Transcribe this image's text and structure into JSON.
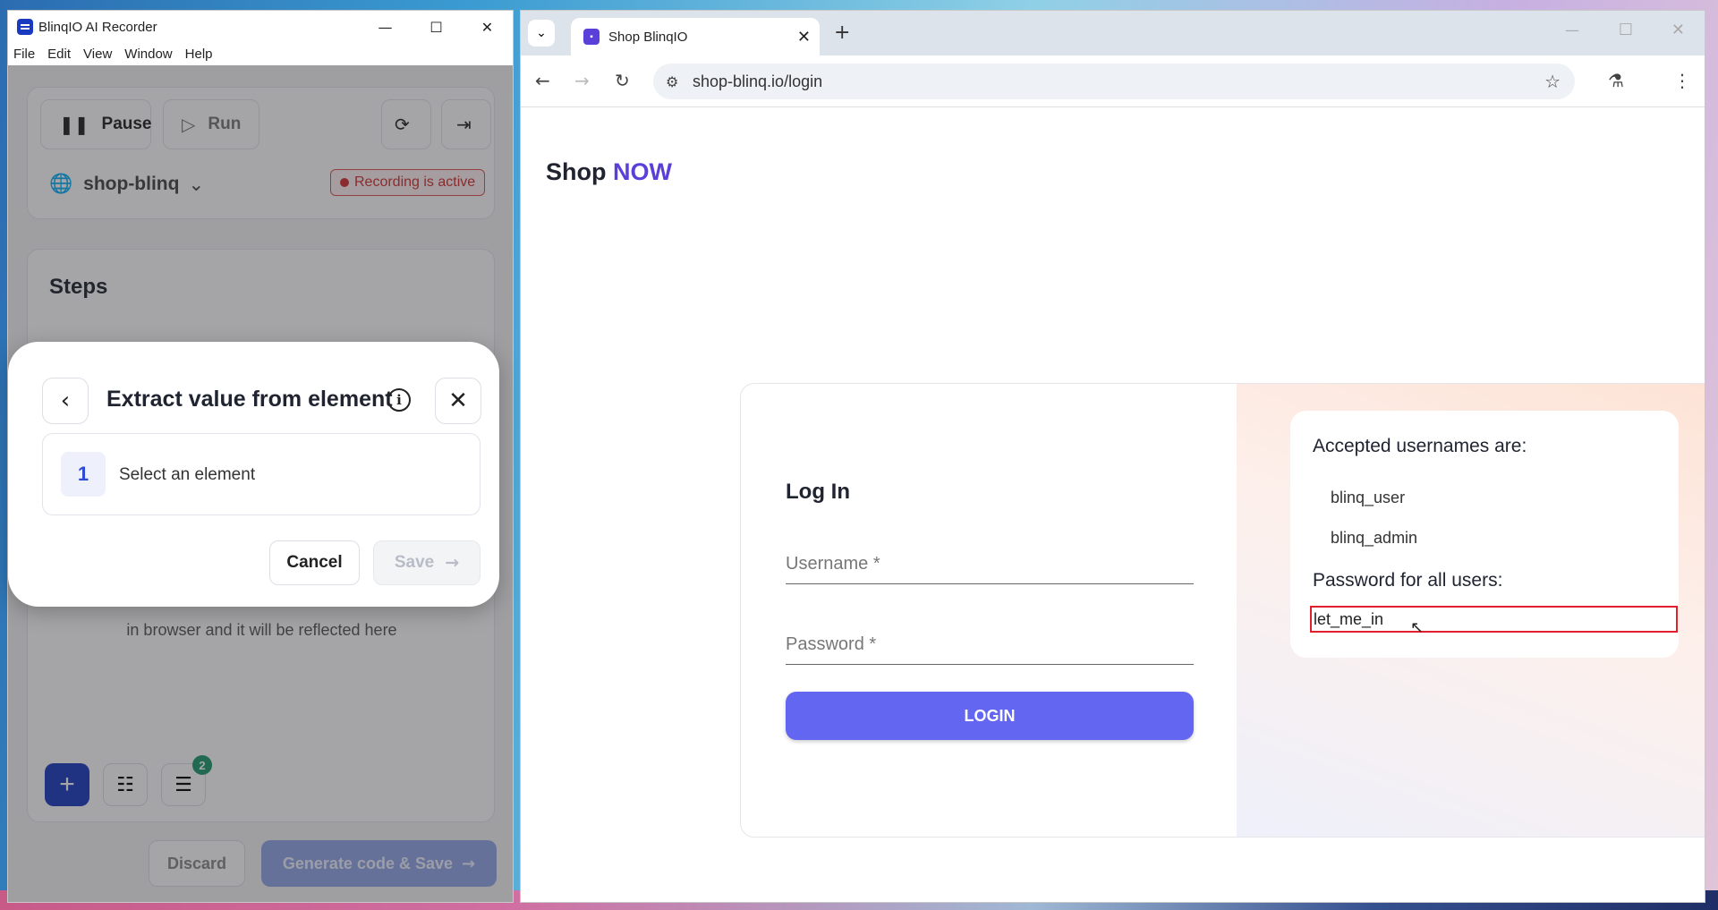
{
  "recorder": {
    "title": "BlinqIO AI Recorder",
    "menu": [
      "File",
      "Edit",
      "View",
      "Window",
      "Help"
    ],
    "pause_label": "Pause",
    "run_label": "Run",
    "project": "shop-blinq",
    "recording_status": "Recording is active",
    "steps_title": "Steps",
    "hint_text": "in browser and it will be reflected here",
    "steps_badge": "2",
    "discard_label": "Discard",
    "generate_label": "Generate code & Save"
  },
  "modal": {
    "title": "Extract value from element",
    "step_number": "1",
    "step_label": "Select an element",
    "cancel_label": "Cancel",
    "save_label": "Save"
  },
  "browser": {
    "tab_title": "Shop BlinqIO",
    "url": "shop-blinq.io/login"
  },
  "page": {
    "logo_shop": "Shop",
    "logo_now": "NOW",
    "login_title": "Log In",
    "username_placeholder": "Username *",
    "password_placeholder": "Password *",
    "login_button": "LOGIN",
    "accepted_heading": "Accepted usernames are:",
    "usernames": [
      "blinq_user",
      "blinq_admin"
    ],
    "password_heading": "Password for all users:",
    "password_value": "let_me_in"
  },
  "colors": {
    "accent": "#6366f1",
    "brand_now": "#5b3fd9",
    "recording": "#d03030",
    "highlight": "#e0202c"
  }
}
